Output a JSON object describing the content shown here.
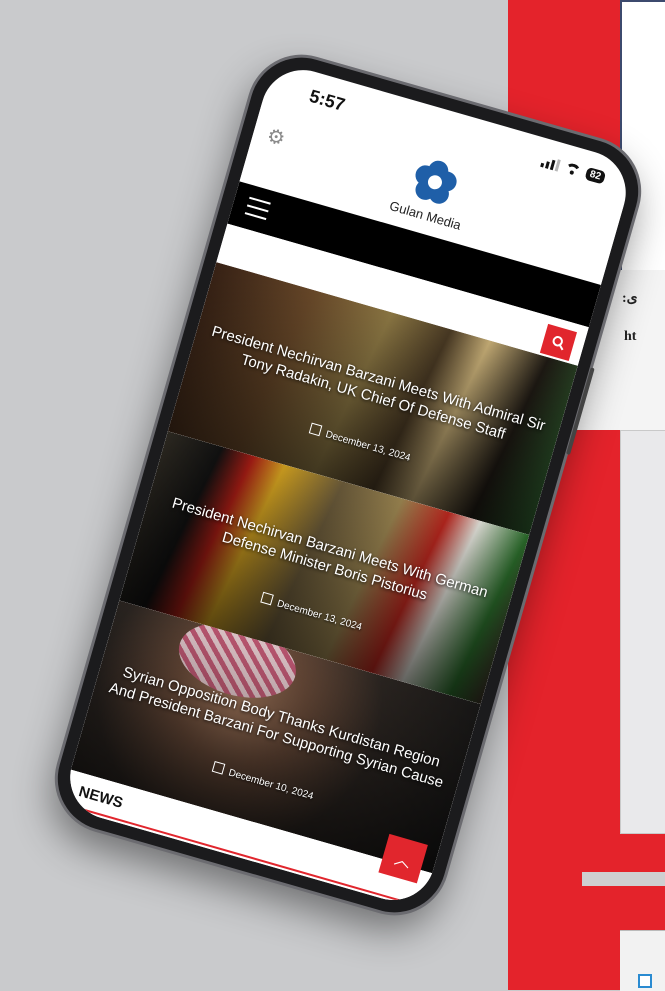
{
  "poster": {
    "text_1": ":ی",
    "text_2": "ht"
  },
  "status_bar": {
    "time": "5:57",
    "battery": "82"
  },
  "header": {
    "brand": "Gulan Media",
    "icons": [
      "gear-icon",
      "flower-logo",
      "hamburger-icon",
      "search-icon"
    ]
  },
  "articles": [
    {
      "title": "President Nechirvan Barzani Meets With Admiral Sir Tony Radakin, UK Chief Of Defense Staff",
      "date": "December 13, 2024"
    },
    {
      "title": "President Nechirvan Barzani Meets With German Defense Minister Boris Pistorius",
      "date": "December 13, 2024"
    },
    {
      "title": "Syrian Opposition Body Thanks Kurdistan Region And President Barzani For Supporting Syrian Cause",
      "date": "December 10, 2024"
    }
  ],
  "section": {
    "label": "NEWS"
  },
  "colors": {
    "accent": "#e1262d",
    "logo_blue": "#1f5fa8",
    "poster_red": "#e4232b"
  }
}
